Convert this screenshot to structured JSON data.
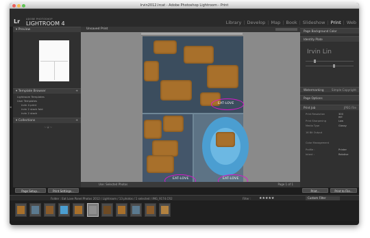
{
  "window": {
    "title": "Irvin2012.lrcat - Adobe Photoshop Lightroom - Print"
  },
  "identity_plate": {
    "badge": "Lr",
    "brand_top": "ADOBE PHOTOSHOP",
    "brand": "LIGHTROOM 4"
  },
  "modules": [
    "Library",
    "Develop",
    "Map",
    "Book",
    "Slideshow",
    "Print",
    "Web"
  ],
  "active_module": "Print",
  "left_panel": {
    "preview_title": "Preview",
    "templates_title": "Template Browser",
    "templates": [
      "Lightroom Templates",
      "User Templates",
      "irvin 4 print",
      "irvin 2 stack fold",
      "irvin 2 stack"
    ],
    "collections_title": "Collections",
    "page_setup_btn": "Page Setup...",
    "print_settings_btn": "Print Settings..."
  },
  "center": {
    "toolbar_label": "Unsaved Print",
    "watermark": "EAT-LOVE",
    "footer_left": "Use: Selected Photos",
    "footer_right": "Page 1 of 1"
  },
  "right_panel": {
    "identity_text": "Irvin Lin",
    "headers": [
      "Page Background Color",
      "Identity Plate",
      "Watermarking",
      "Page Options",
      "Print Job",
      "Print Resolution",
      "Print Sharpening",
      "Media Type",
      "16 Bit Output",
      "Color Management"
    ],
    "watermark_value": "Simple Copyright",
    "print_to_value": "JPEG File",
    "print_res_value": "300 ppi",
    "print_sharp_value": "Low",
    "media_value": "Glossy",
    "profile_value": "Printer",
    "intent_value": "Relative",
    "print_btn": "Print...",
    "printer_btn": "Print to File..."
  },
  "filmstrip_bar": {
    "info": "Folder : Eat Love Panel Photos 2012 / Lightroom / 13 photos / 1 selected / IMG_9174.CR2",
    "filter_label": "Filter :",
    "stars": "★★★★★",
    "custom_filter": "Custom Filter"
  },
  "filmstrip": {
    "count": 11,
    "selected_index": 5
  },
  "colors": {
    "accent_oval": "#d619c9",
    "plate_blue": "#4b9ed1",
    "caramel": "#a8702b"
  }
}
